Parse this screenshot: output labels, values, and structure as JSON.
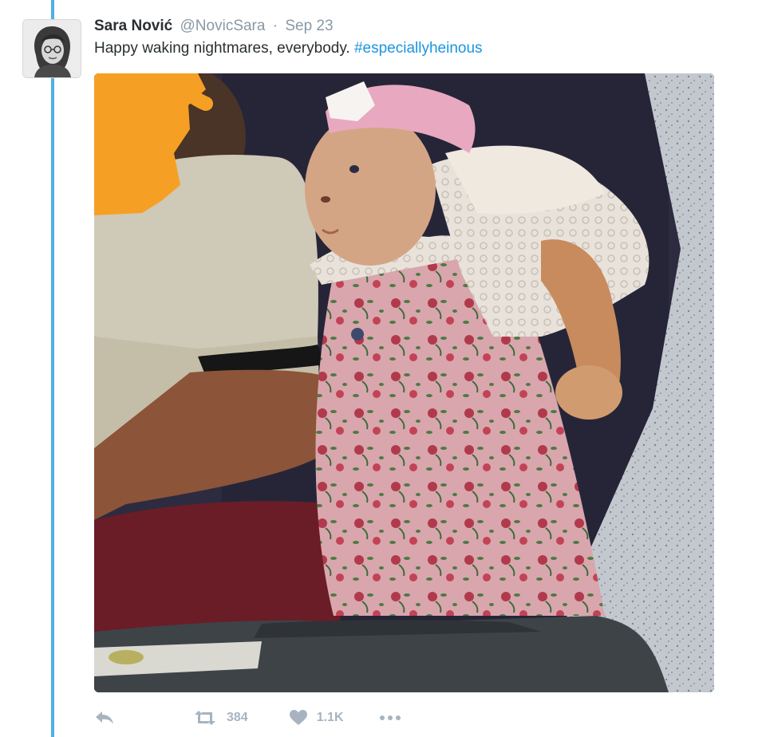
{
  "tweet": {
    "fullname": "Sara Nović",
    "screen_name": "@NovicSara",
    "separator": "·",
    "timestamp": "Sep 23",
    "text": "Happy waking nightmares, everybody.",
    "hashtag": "#especiallyheinous"
  },
  "actions": {
    "retweet_count": "384",
    "like_count": "1.1K"
  },
  "icons": {
    "reply": "reply-icon",
    "retweet": "retweet-icon",
    "like": "heart-icon",
    "more": "more-dots-icon"
  },
  "colors": {
    "thread_line": "#4fb0e6",
    "hashtag": "#1b95e0",
    "secondary_text": "#8899a6",
    "action_icons": "#a7b4bf"
  }
}
